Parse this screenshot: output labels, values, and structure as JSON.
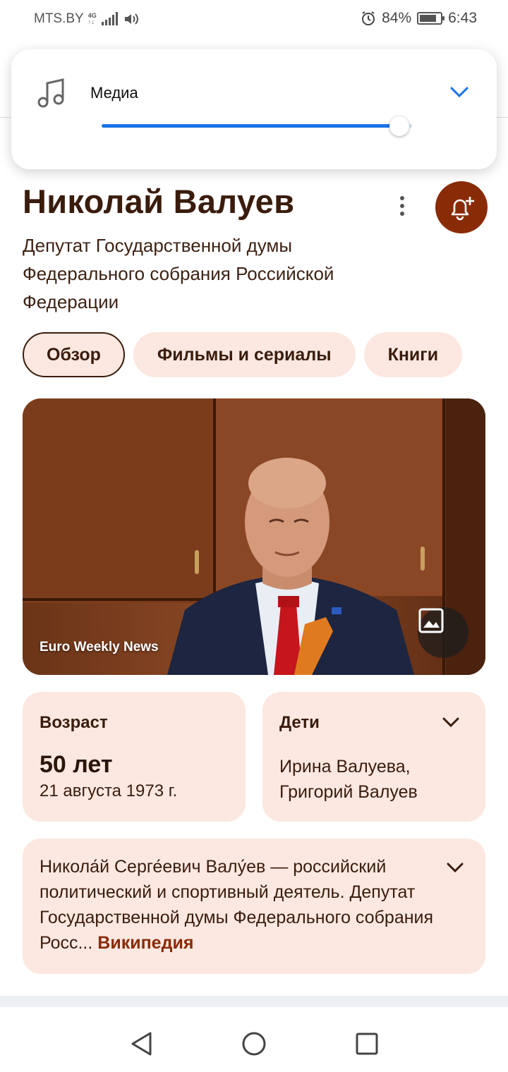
{
  "status_bar": {
    "carrier": "MTS.BY",
    "network_top": "4G",
    "network_bottom": "↑↓",
    "battery": "84%",
    "battery_level": 0.84,
    "time": "6:43"
  },
  "media_popup": {
    "label": "Медиа",
    "volume_level": 0.96,
    "accent_color": "#1a73e8"
  },
  "header": {
    "title": "Николай Валуев",
    "subtitle": "Депутат Государственной думы Федерального собрания Российской Федерации"
  },
  "chips": [
    {
      "label": "Обзор",
      "active": true
    },
    {
      "label": "Фильмы и сериалы",
      "active": false
    },
    {
      "label": "Книги",
      "active": false
    }
  ],
  "photo": {
    "source": "Euro Weekly News"
  },
  "age_card": {
    "label": "Возраст",
    "value": "50 лет",
    "date": "21 августа 1973 г."
  },
  "kids_card": {
    "label": "Дети",
    "value": "Ирина Валуева, Григорий Валуев"
  },
  "bio_card": {
    "text": "Никола́й Серге́евич Валу́ев — российский политический и спортивный деятель. Депутат Государственной думы Федерального собрания Росс...",
    "link": "Википедия"
  },
  "theme": {
    "accent": "#8a2b08",
    "card_bg": "#fce8e1",
    "text": "#3a1c0d"
  }
}
